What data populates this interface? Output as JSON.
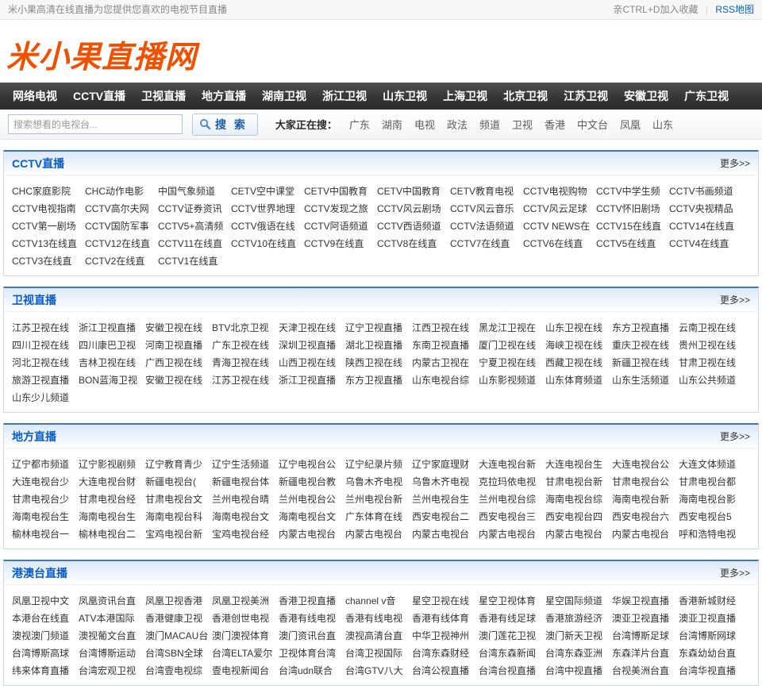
{
  "topbar": {
    "slogan": "米小果高清在线直播为您提供您喜欢的电视节目直播",
    "favorite_label": "亲CTRL+D加入收藏",
    "divider": "|",
    "rss_label": "RSS地图"
  },
  "logo": {
    "text": "米小果直播网"
  },
  "nav": {
    "items": [
      "网络电视",
      "CCTV直播",
      "卫视直播",
      "地方直播",
      "湖南卫视",
      "浙江卫视",
      "山东卫视",
      "上海卫视",
      "北京卫视",
      "江苏卫视",
      "安徽卫视",
      "广东卫视"
    ]
  },
  "search": {
    "placeholder": "搜索想看的电视台...",
    "button_label": "搜 索",
    "hot_label": "大家正在搜：",
    "hot_links": [
      "广东",
      "湖南",
      "电视",
      "政法",
      "频道",
      "卫视",
      "香港",
      "中文台",
      "凤凰",
      "山东"
    ]
  },
  "sections": [
    {
      "title": "CCTV直播",
      "more": "更多>>",
      "channels": [
        "CHC家庭影院",
        "CHC动作电影",
        "中国气象频道",
        "CETV空中课堂",
        "CETV中国教育",
        "CETV中国教育",
        "CETV教育电视",
        "CCTV电视购物",
        "CCTV中学生频",
        "CCTV书画频道",
        "CCTV电视指南",
        "CCTV高尔夫网",
        "CCTV证券资讯",
        "CCTV世界地理",
        "CCTV发现之旅",
        "CCTV风云剧场",
        "CCTV风云音乐",
        "CCTV风云足球",
        "CCTV怀旧剧场",
        "CCTV央视精品",
        "CCTV第一剧场",
        "CCTV国防军事",
        "CCTV5+高清频",
        "CCTV俄语在线",
        "CCTV阿语频道",
        "CCTV西语频道",
        "CCTV法语频道",
        "CCTV NEWS在",
        "CCTV15在线直",
        "CCTV14在线直",
        "CCTV13在线直",
        "CCTV12在线直",
        "CCTV11在线直",
        "CCTV10在线直",
        "CCTV9在线直",
        "CCTV8在线直",
        "CCTV7在线直",
        "CCTV6在线直",
        "CCTV5在线直",
        "CCTV4在线直",
        "CCTV3在线直",
        "CCTV2在线直",
        "CCTV1在线直"
      ]
    },
    {
      "title": "卫视直播",
      "more": "更多>>",
      "channels": [
        "江苏卫视在线",
        "浙江卫视直播",
        "安徽卫视在线",
        "BTV北京卫视",
        "天津卫视在线",
        "辽宁卫视直播",
        "江西卫视在线",
        "黑龙江卫视在",
        "山东卫视在线",
        "东方卫视直播",
        "云南卫视在线",
        "四川卫视在线",
        "四川康巴卫视",
        "河南卫视直播",
        "广东卫视在线",
        "深圳卫视直播",
        "湖北卫视直播",
        "东南卫视直播",
        "厦门卫视在线",
        "海峡卫视在线",
        "重庆卫视在线",
        "贵州卫视在线",
        "河北卫视在线",
        "吉林卫视在线",
        "广西卫视在线",
        "青海卫视在线",
        "山西卫视在线",
        "陕西卫视在线",
        "内蒙古卫视在",
        "宁夏卫视在线",
        "西藏卫视在线",
        "新疆卫视在线",
        "甘肃卫视在线",
        "旅游卫视直播",
        "BON蓝海卫视",
        "安徽卫视在线",
        "江苏卫视在线",
        "浙江卫视直播",
        "东方卫视直播",
        "山东电视台综",
        "山东影视频道",
        "山东体育频道",
        "山东生活频道",
        "山东公共频道",
        "山东少儿频道"
      ]
    },
    {
      "title": "地方直播",
      "more": "更多>>",
      "channels": [
        "辽宁都市频道",
        "辽宁影视剧频",
        "辽宁教育青少",
        "辽宁生活频道",
        "辽宁电视台公",
        "辽宁纪录片频",
        "辽宁家庭理财",
        "大连电视台新",
        "大连电视台生",
        "大连电视台公",
        "大连文体频道",
        "大连电视台少",
        "大连电视台财",
        "新疆电视台(",
        "新疆电视台体",
        "新疆电视台教",
        "乌鲁木齐电视",
        "乌鲁木齐电视",
        "克拉玛依电视",
        "甘肃电视台新",
        "甘肃电视台公",
        "甘肃电视台都",
        "甘肃电视台少",
        "甘肃电视台经",
        "甘肃电视台文",
        "兰州电视台晴",
        "兰州电视台公",
        "兰州电视台新",
        "兰州电视台生",
        "兰州电视台综",
        "海南电视台综",
        "海南电视台新",
        "海南电视台影",
        "海南电视台生",
        "海南电视台生",
        "海南电视台科",
        "海南电视台文",
        "海南电视台文",
        "广东体育在线",
        "西安电视台二",
        "西安电视台三",
        "西安电视台四",
        "西安电视台六",
        "西安电视台5",
        "榆林电视台一",
        "榆林电视台二",
        "宝鸡电视台新",
        "宝鸡电视台经",
        "内蒙古电视台",
        "内蒙古电视台",
        "内蒙古电视台",
        "内蒙古电视台",
        "内蒙古电视台",
        "内蒙古电视台",
        "呼和浩特电视"
      ]
    },
    {
      "title": "港澳台直播",
      "more": "更多>>",
      "channels": [
        "凤凰卫视中文",
        "凤凰资讯台直",
        "凤凰卫视香港",
        "凤凰卫视美洲",
        "香港卫视直播",
        "channel v音",
        "星空卫视在线",
        "星空卫视体育",
        "星空国际频道",
        "华娱卫视直播",
        "香港新城财经",
        "本港台在线直",
        "ATV本港国际",
        "香港健康卫视",
        "香港创世电视",
        "香港有线电视",
        "香港有线电视",
        "香港有线体育",
        "香港有线足球",
        "香港旅游经济",
        "澳亚卫视直播",
        "澳亚卫视直播",
        "澳视澳门频道",
        "澳视葡文台直",
        "澳门MACAU台",
        "澳门澳视体育",
        "澳门资讯台直",
        "澳视高清台直",
        "中华卫视神州",
        "澳门莲花卫视",
        "澳门新天卫视",
        "台湾博斯足球",
        "台湾博斯网球",
        "台湾博斯高球",
        "台湾博斯运动",
        "台湾SBN全球",
        "台湾ELTA爱尔",
        "卫视体育台湾",
        "台湾卫视国际",
        "台湾东森财经",
        "台湾东森新闻",
        "台湾东森亚洲",
        "东森洋片台直",
        "东森幼幼台直",
        "纬来体育直播",
        "台湾宏观卫视",
        "台湾壹电视综",
        "壹电视新闻台",
        "台湾udn联合",
        "台湾GTV八大",
        "台湾公视直播",
        "台湾台视直播",
        "台湾中视直播",
        "台视美洲台直",
        "台湾华视直播"
      ]
    }
  ],
  "colors": {
    "logo_orange": "#f05000",
    "nav_bg_dark": "#363636",
    "section_top_border_blue": "#3d77bb",
    "section_title_blue": "#0a5cc8",
    "section_header_gradient_top": "#dbe8f8",
    "channel_link_color": "#333333",
    "rss_link_blue": "#0862c6",
    "search_button_blue": "#1e5fa9"
  }
}
